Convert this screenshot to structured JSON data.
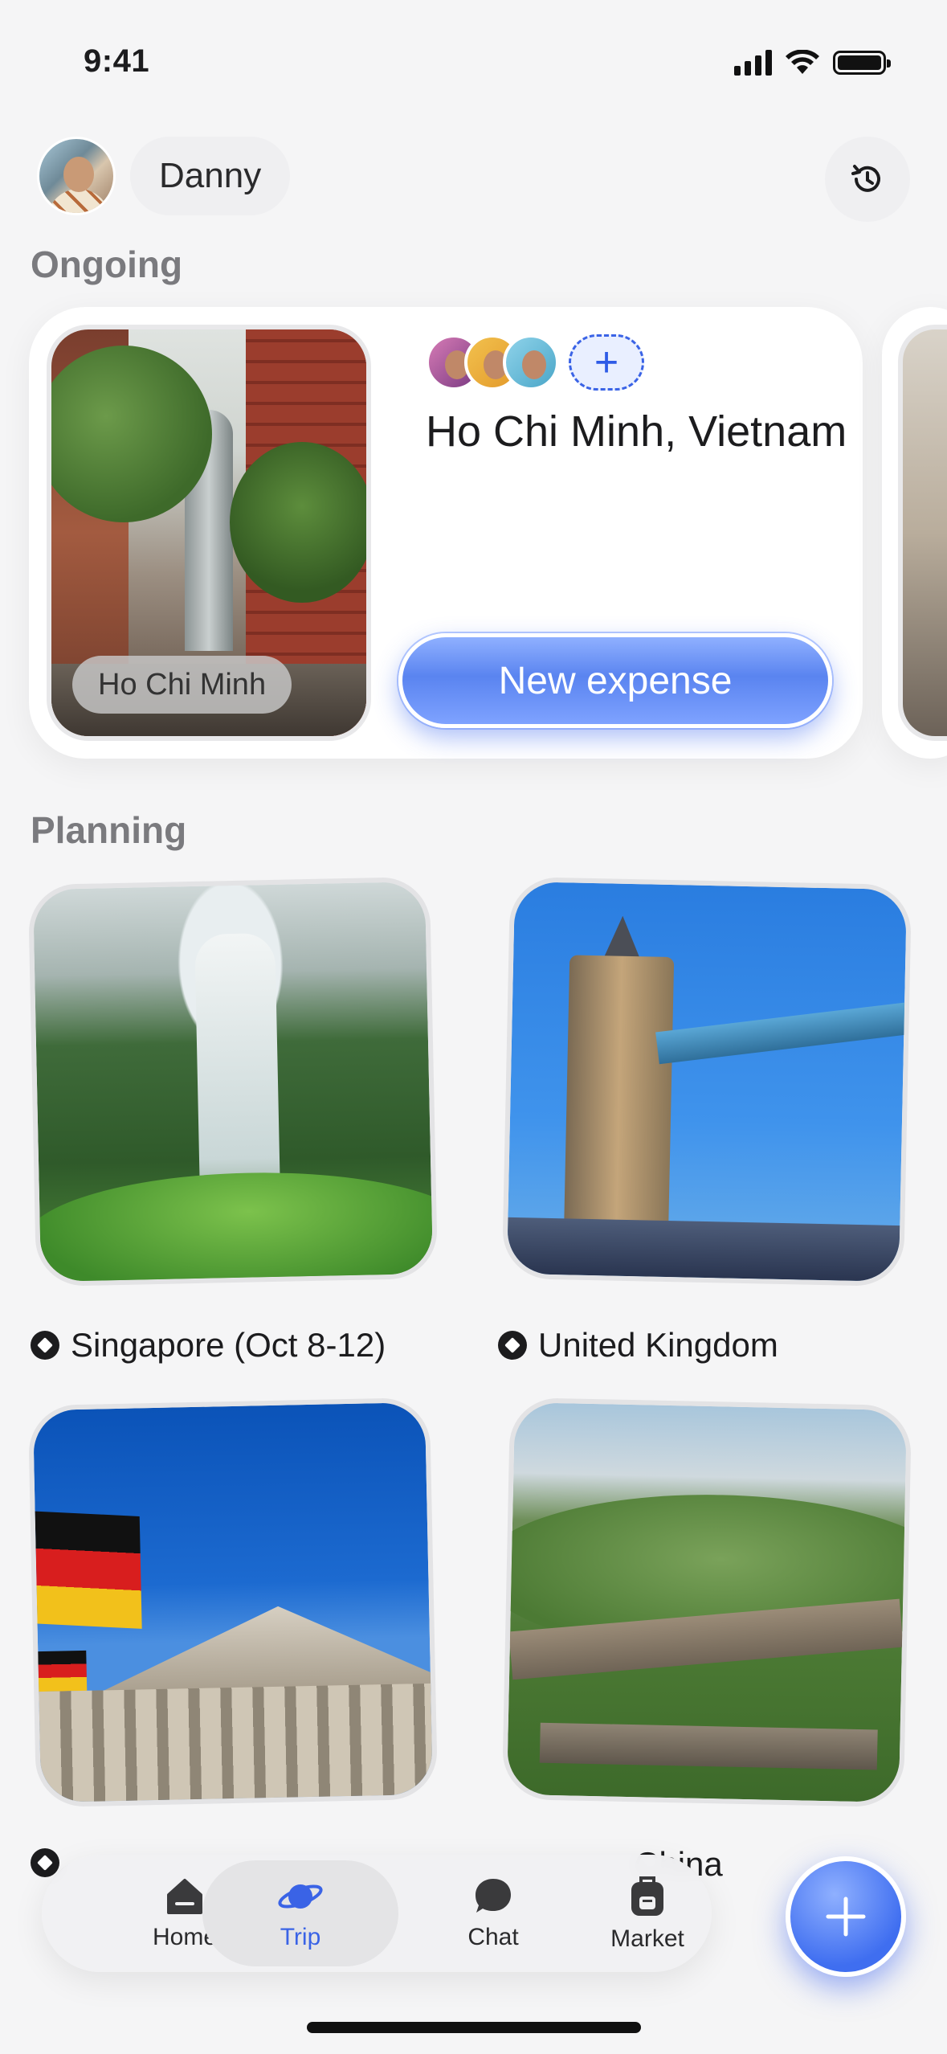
{
  "status_bar": {
    "time": "9:41"
  },
  "header": {
    "user_name": "Danny"
  },
  "sections": {
    "ongoing": "Ongoing",
    "planning": "Planning"
  },
  "ongoing_trip": {
    "photo_tag": "Ho Chi Minh",
    "title": "Ho Chi Minh, Vietnam",
    "add_member": "+",
    "action_label": "New expense"
  },
  "planning_trips": [
    {
      "label": "Singapore (Oct 8-12)"
    },
    {
      "label": "United Kingdom"
    },
    {
      "label": ""
    },
    {
      "label": "China"
    }
  ],
  "nav": {
    "items": [
      {
        "label": "Home",
        "icon": "home-icon"
      },
      {
        "label": "Trip",
        "icon": "planet-icon",
        "active": true
      },
      {
        "label": "Chat",
        "icon": "chat-icon"
      },
      {
        "label": "Market",
        "icon": "backpack-icon"
      }
    ]
  },
  "colors": {
    "accent": "#3a63e6",
    "background": "#f5f5f6",
    "card": "#ffffff"
  }
}
